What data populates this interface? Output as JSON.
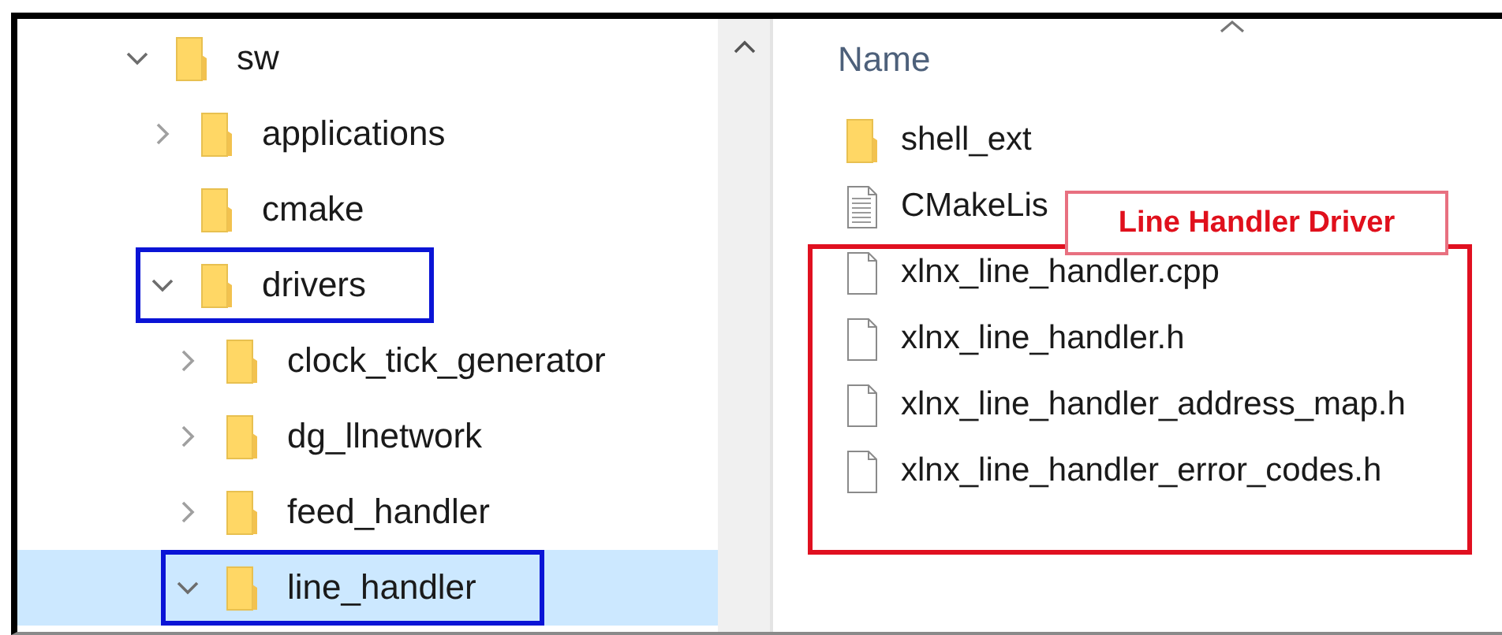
{
  "tree": [
    {
      "label": "sw",
      "expandable": true,
      "expanded": true,
      "selected": false,
      "boxed": false,
      "children": [
        {
          "label": "applications",
          "expandable": true,
          "expanded": false,
          "selected": false,
          "boxed": false
        },
        {
          "label": "cmake",
          "expandable": false,
          "selected": false,
          "boxed": false
        },
        {
          "label": "drivers",
          "expandable": true,
          "expanded": true,
          "selected": false,
          "boxed": true,
          "children": [
            {
              "label": "clock_tick_generator",
              "expandable": true,
              "expanded": false,
              "selected": false,
              "boxed": false
            },
            {
              "label": "dg_llnetwork",
              "expandable": true,
              "expanded": false,
              "selected": false,
              "boxed": false
            },
            {
              "label": "feed_handler",
              "expandable": true,
              "expanded": false,
              "selected": false,
              "boxed": false
            },
            {
              "label": "line_handler",
              "expandable": true,
              "expanded": true,
              "selected": true,
              "boxed": true
            }
          ]
        }
      ]
    }
  ],
  "files": {
    "column": "Name",
    "items": [
      {
        "name": "shell_ext",
        "kind": "folder"
      },
      {
        "name": "CMakeLis",
        "kind": "text"
      },
      {
        "name": "xlnx_line_handler.cpp",
        "kind": "file"
      },
      {
        "name": "xlnx_line_handler.h",
        "kind": "file"
      },
      {
        "name": "xlnx_line_handler_address_map.h",
        "kind": "file"
      },
      {
        "name": "xlnx_line_handler_error_codes.h",
        "kind": "file"
      }
    ]
  },
  "annotation": {
    "label": "Line Handler Driver"
  }
}
